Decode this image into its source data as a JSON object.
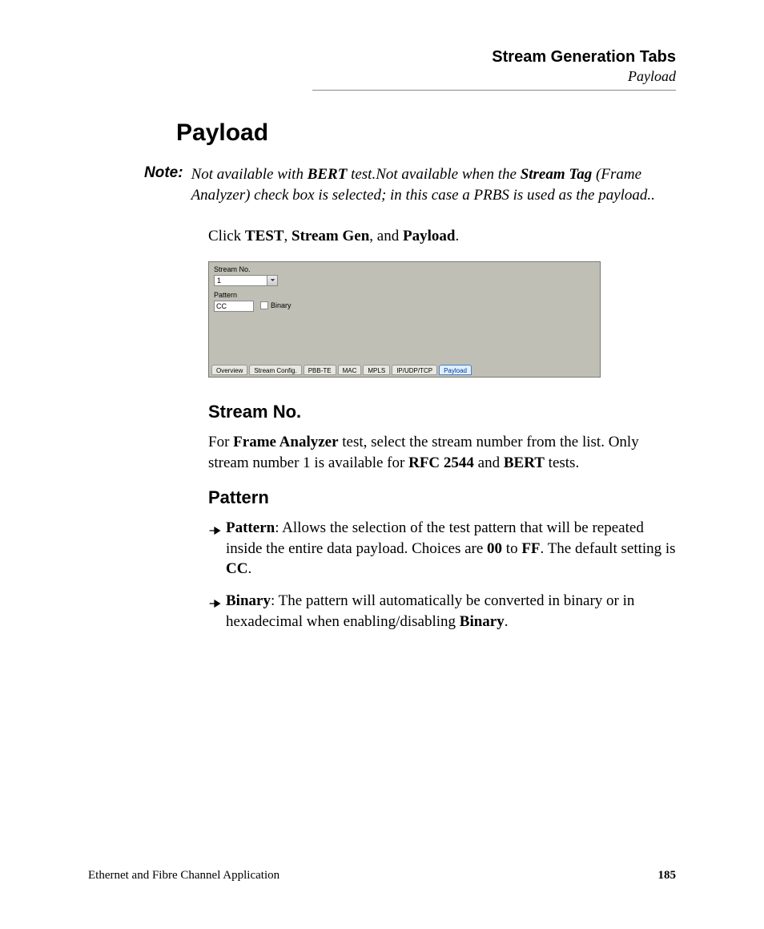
{
  "header": {
    "title": "Stream Generation Tabs",
    "subtitle": "Payload"
  },
  "heading": "Payload",
  "note": {
    "label": "Note:",
    "pre": "Not available with ",
    "b1": "BERT",
    "mid1": " test.Not available when the ",
    "b2": "Stream Tag",
    "mid2": " (Frame Analyzer) check box is selected; in this case a PRBS is used as the payload.."
  },
  "clickLine": {
    "pre": "Click ",
    "b1": "TEST",
    "s1": ", ",
    "b2": "Stream Gen",
    "s2": ", and ",
    "b3": "Payload",
    "post": "."
  },
  "screenshot": {
    "streamNoLabel": "Stream No.",
    "streamNoValue": "1",
    "patternLabel": "Pattern",
    "patternValue": "CC",
    "binaryLabel": "Binary",
    "tabs": [
      "Overview",
      "Stream Config.",
      "PBB-TE",
      "MAC",
      "MPLS",
      "IP/UDP/TCP",
      "Payload"
    ]
  },
  "section1": {
    "heading": "Stream No.",
    "p_pre": "For ",
    "p_b1": "Frame Analyzer",
    "p_mid": " test, select the stream number from the list. Only stream number 1 is available for ",
    "p_b2": "RFC 2544",
    "p_and": " and ",
    "p_b3": "BERT",
    "p_post": " tests."
  },
  "section2": {
    "heading": "Pattern",
    "bullets": [
      {
        "b1": "Pattern",
        "t1": ": Allows the selection of the test pattern that will be repeated inside the entire data payload. Choices are ",
        "b2": "00",
        "t2": " to ",
        "b3": "FF",
        "t3": ". The default setting is ",
        "b4": "CC",
        "t4": "."
      },
      {
        "b1": "Binary",
        "t1": ": The pattern will automatically be converted in binary or in hexadecimal when enabling/disabling ",
        "b2": "Binary",
        "t2": ".",
        "b3": "",
        "t3": "",
        "b4": "",
        "t4": ""
      }
    ]
  },
  "footer": {
    "left": "Ethernet and Fibre Channel Application",
    "right": "185"
  }
}
